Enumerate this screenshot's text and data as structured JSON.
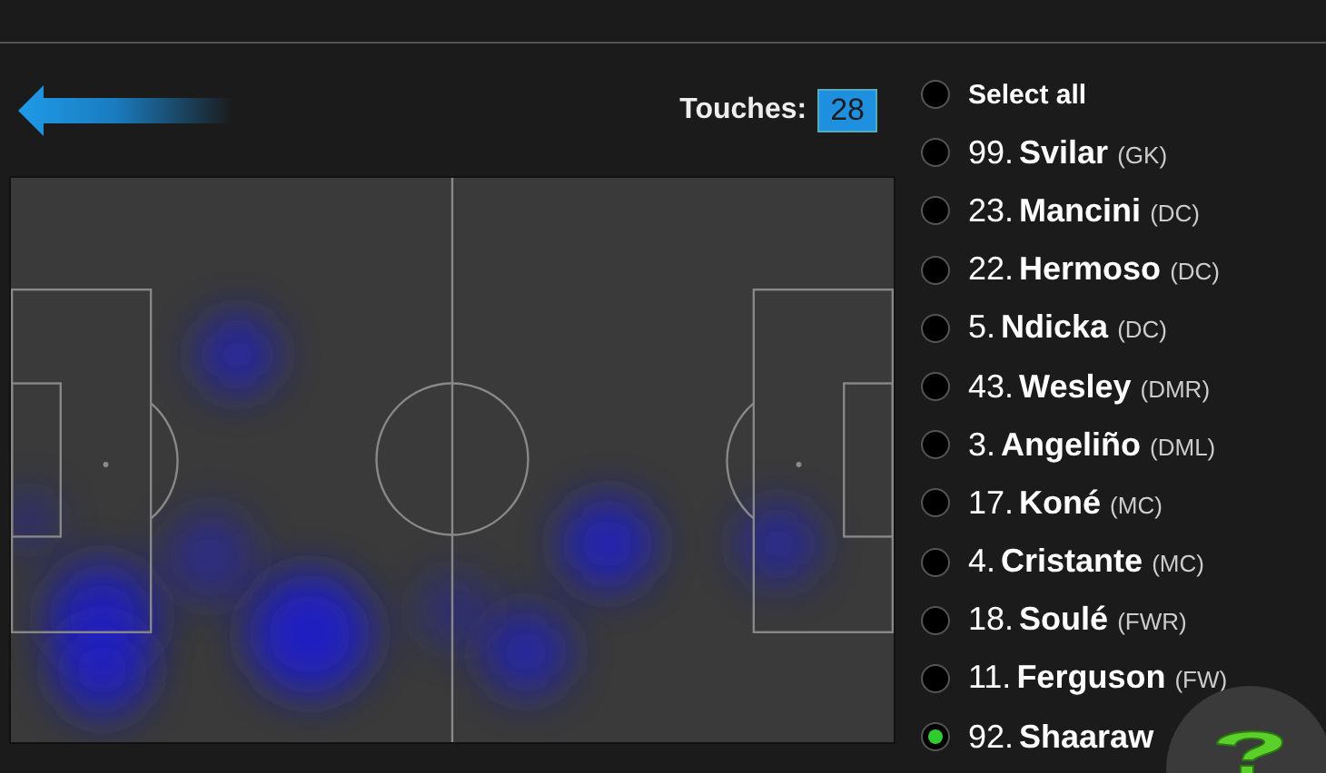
{
  "back": {
    "kind": "arrow"
  },
  "touches": {
    "label": "Touches:",
    "value": "28"
  },
  "select_all": {
    "label": "Select all",
    "selected": false
  },
  "players": [
    {
      "number": "99.",
      "name": "Svilar",
      "position": "(GK)",
      "selected": false
    },
    {
      "number": "23.",
      "name": "Mancini",
      "position": "(DC)",
      "selected": false
    },
    {
      "number": "22.",
      "name": "Hermoso",
      "position": "(DC)",
      "selected": false
    },
    {
      "number": "5.",
      "name": "Ndicka",
      "position": "(DC)",
      "selected": false
    },
    {
      "number": "43.",
      "name": "Wesley",
      "position": "(DMR)",
      "selected": false
    },
    {
      "number": "3.",
      "name": "Angeliño",
      "position": "(DML)",
      "selected": false
    },
    {
      "number": "17.",
      "name": "Koné",
      "position": "(MC)",
      "selected": false
    },
    {
      "number": "4.",
      "name": "Cristante",
      "position": "(MC)",
      "selected": false
    },
    {
      "number": "18.",
      "name": "Soulé",
      "position": "(FWR)",
      "selected": false
    },
    {
      "number": "11.",
      "name": "Ferguson",
      "position": "(FW)",
      "selected": false
    },
    {
      "number": "92.",
      "name": "Shaaraw",
      "selected": true
    }
  ]
}
